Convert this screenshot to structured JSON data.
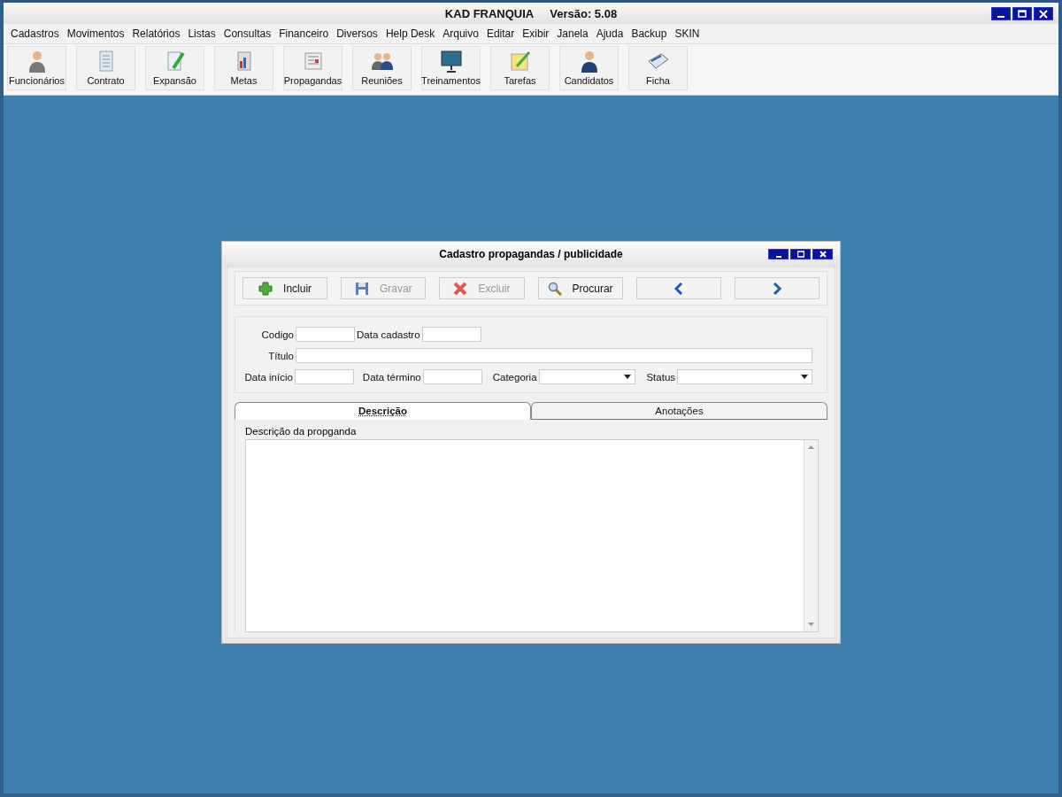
{
  "window": {
    "title": "KAD FRANQUIA",
    "version": "Versão: 5.08"
  },
  "menu": [
    "Cadastros",
    "Movimentos",
    "Relatórios",
    "Listas",
    "Consultas",
    "Financeiro",
    "Diversos",
    "Help Desk",
    "Arquivo",
    "Editar",
    "Exibir",
    "Janela",
    "Ajuda",
    "Backup",
    "SKIN"
  ],
  "toolbar": [
    {
      "label": "Funcionários"
    },
    {
      "label": "Contrato"
    },
    {
      "label": "Expansão"
    },
    {
      "label": "Metas"
    },
    {
      "label": "Propagandas"
    },
    {
      "label": "Reuniões"
    },
    {
      "label": "Treinamentos"
    },
    {
      "label": "Tarefas"
    },
    {
      "label": "Candidatos"
    },
    {
      "label": "Ficha"
    }
  ],
  "dialog": {
    "title": "Cadastro propagandas / publicidade",
    "actions": [
      {
        "kind": "add",
        "label": "Incluir",
        "disabled": false
      },
      {
        "kind": "save",
        "label": "Gravar",
        "disabled": true
      },
      {
        "kind": "delete",
        "label": "Excluir",
        "disabled": true
      },
      {
        "kind": "search",
        "label": "Procurar",
        "disabled": false
      },
      {
        "kind": "prev",
        "disabled": false
      },
      {
        "kind": "next",
        "disabled": false
      }
    ],
    "fields": {
      "codigo": {
        "label": "Codigo"
      },
      "data_cadastro": {
        "label": "Data cadastro"
      },
      "titulo": {
        "label": "Título"
      },
      "data_inicio": {
        "label": "Data início"
      },
      "data_termino": {
        "label": "Data término"
      },
      "categoria": {
        "label": "Categoria"
      },
      "status": {
        "label": "Status"
      }
    },
    "tabs": [
      {
        "label": "Descrição",
        "selected": true
      },
      {
        "label": "Anotações",
        "selected": false
      }
    ],
    "description_label": "Descrição da propganda"
  }
}
